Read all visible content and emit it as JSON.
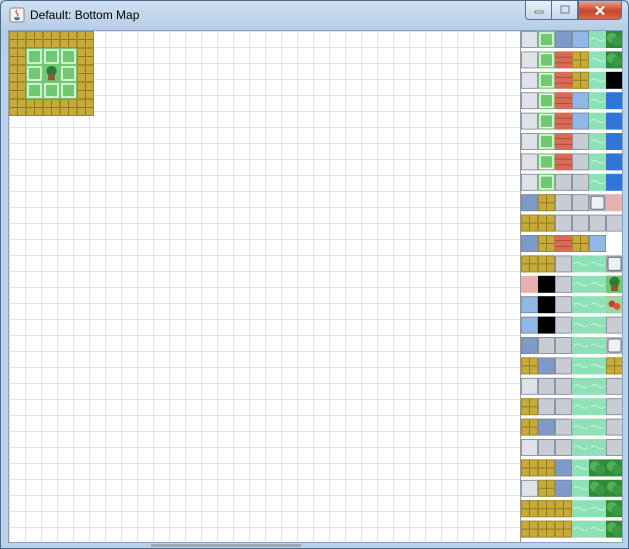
{
  "window": {
    "title": "Default: Bottom Map",
    "controls": [
      "minimize-icon",
      "maximize-icon",
      "close-icon"
    ]
  },
  "map": {
    "grid_cell_size_label": "",
    "placed_tiles": [
      [
        "floor-gold",
        "floor-gold",
        "floor-gold",
        "floor-gold",
        "floor-gold"
      ],
      [
        "floor-gold",
        "mat-green",
        "mat-green",
        "mat-green",
        "floor-gold"
      ],
      [
        "floor-gold",
        "mat-green",
        "potted-plant",
        "mat-green",
        "floor-gold"
      ],
      [
        "floor-gold",
        "mat-green",
        "mat-green",
        "mat-green",
        "floor-gold"
      ],
      [
        "floor-gold",
        "floor-gold",
        "floor-gold",
        "floor-gold",
        "floor-gold"
      ]
    ]
  },
  "palette": {
    "columns": 6,
    "tile_names": [
      [
        "wall-gray",
        "mat-green",
        "counter-blue",
        "floor-blue",
        "water-light",
        "tree-green"
      ],
      [
        "wall-gray",
        "mat-green",
        "roof-red",
        "floor-gold",
        "water-light",
        "tree-green"
      ],
      [
        "wall-gray",
        "mat-green",
        "roof-red",
        "floor-gold",
        "water-light",
        "void-black"
      ],
      [
        "wall-gray",
        "mat-green",
        "roof-red",
        "floor-blue",
        "water-light",
        "water-deep"
      ],
      [
        "wall-gray",
        "mat-green",
        "roof-red",
        "floor-blue",
        "water-light",
        "water-deep"
      ],
      [
        "wall-gray",
        "mat-green",
        "roof-red",
        "floor-gray",
        "water-light",
        "water-deep"
      ],
      [
        "wall-gray",
        "mat-green",
        "roof-red",
        "floor-gray",
        "water-light",
        "water-deep"
      ],
      [
        "wall-gray",
        "mat-green",
        "floor-gray",
        "floor-gray",
        "water-light",
        "water-deep"
      ],
      [
        "counter-blue",
        "floor-gold",
        "floor-gray",
        "floor-gray",
        "machine-gray",
        "sign-pink"
      ],
      [
        "floor-gold",
        "floor-gold",
        "floor-gray",
        "floor-gray",
        "floor-gray",
        "floor-gray"
      ],
      [
        "counter-blue",
        "floor-gold",
        "roof-red",
        "floor-gold",
        "floor-blue",
        "blank"
      ],
      [
        "floor-gold",
        "floor-gold",
        "floor-gray",
        "water-light",
        "water-light",
        "rock-gray"
      ],
      [
        "sign-pink",
        "void-black",
        "floor-gray",
        "water-light",
        "water-light",
        "potted-plant"
      ],
      [
        "floor-blue",
        "void-black",
        "floor-gray",
        "water-light",
        "water-light",
        "flowers-red"
      ],
      [
        "floor-blue",
        "void-black",
        "floor-gray",
        "water-light",
        "water-light",
        "floor-gray"
      ],
      [
        "counter-blue",
        "floor-gray",
        "floor-gray",
        "water-light",
        "water-light",
        "sign-gray"
      ],
      [
        "floor-gold",
        "counter-blue",
        "floor-gray",
        "water-light",
        "water-light",
        "floor-gold"
      ],
      [
        "wall-gray",
        "floor-gray",
        "floor-gray",
        "water-light",
        "water-light",
        "floor-gray"
      ],
      [
        "floor-gold",
        "floor-gray",
        "floor-gray",
        "water-light",
        "water-light",
        "floor-gray"
      ],
      [
        "floor-gold",
        "counter-blue",
        "floor-gray",
        "water-light",
        "water-light",
        "floor-gray"
      ],
      [
        "wall-gray",
        "floor-gray",
        "floor-gray",
        "water-light",
        "water-light",
        "floor-gray"
      ],
      [
        "floor-gold",
        "floor-gold",
        "counter-blue",
        "water-light",
        "tree-green",
        "tree-green"
      ],
      [
        "wall-gray",
        "floor-gold",
        "counter-blue",
        "water-light",
        "tree-green",
        "tree-green"
      ],
      [
        "floor-gold",
        "floor-gold",
        "floor-gold",
        "water-light",
        "water-light",
        "tree-green"
      ],
      [
        "floor-gold",
        "floor-gold",
        "floor-gold",
        "water-light",
        "water-light",
        "tree-green"
      ]
    ]
  },
  "colors": {
    "floor-gold": "#c6ab3c",
    "mat-green": "#72c872",
    "potted-plant": "#4f9a4a",
    "counter-blue": "#7e9ac8",
    "floor-blue": "#8fb8e6",
    "water-light": "#8ee0b6",
    "tree-green": "#2f8a3a",
    "roof-red": "#d86a58",
    "floor-gray": "#c8ccd4",
    "wall-gray": "#dfe3e8",
    "void-black": "#000000",
    "water-deep": "#2f76d6",
    "machine-gray": "#a9b0ba",
    "sign-pink": "#e4b0b0",
    "flowers-red": "#c8403a",
    "rock-gray": "#9aa4a0",
    "sign-gray": "#b4b4b4",
    "blank": "#ffffff"
  }
}
